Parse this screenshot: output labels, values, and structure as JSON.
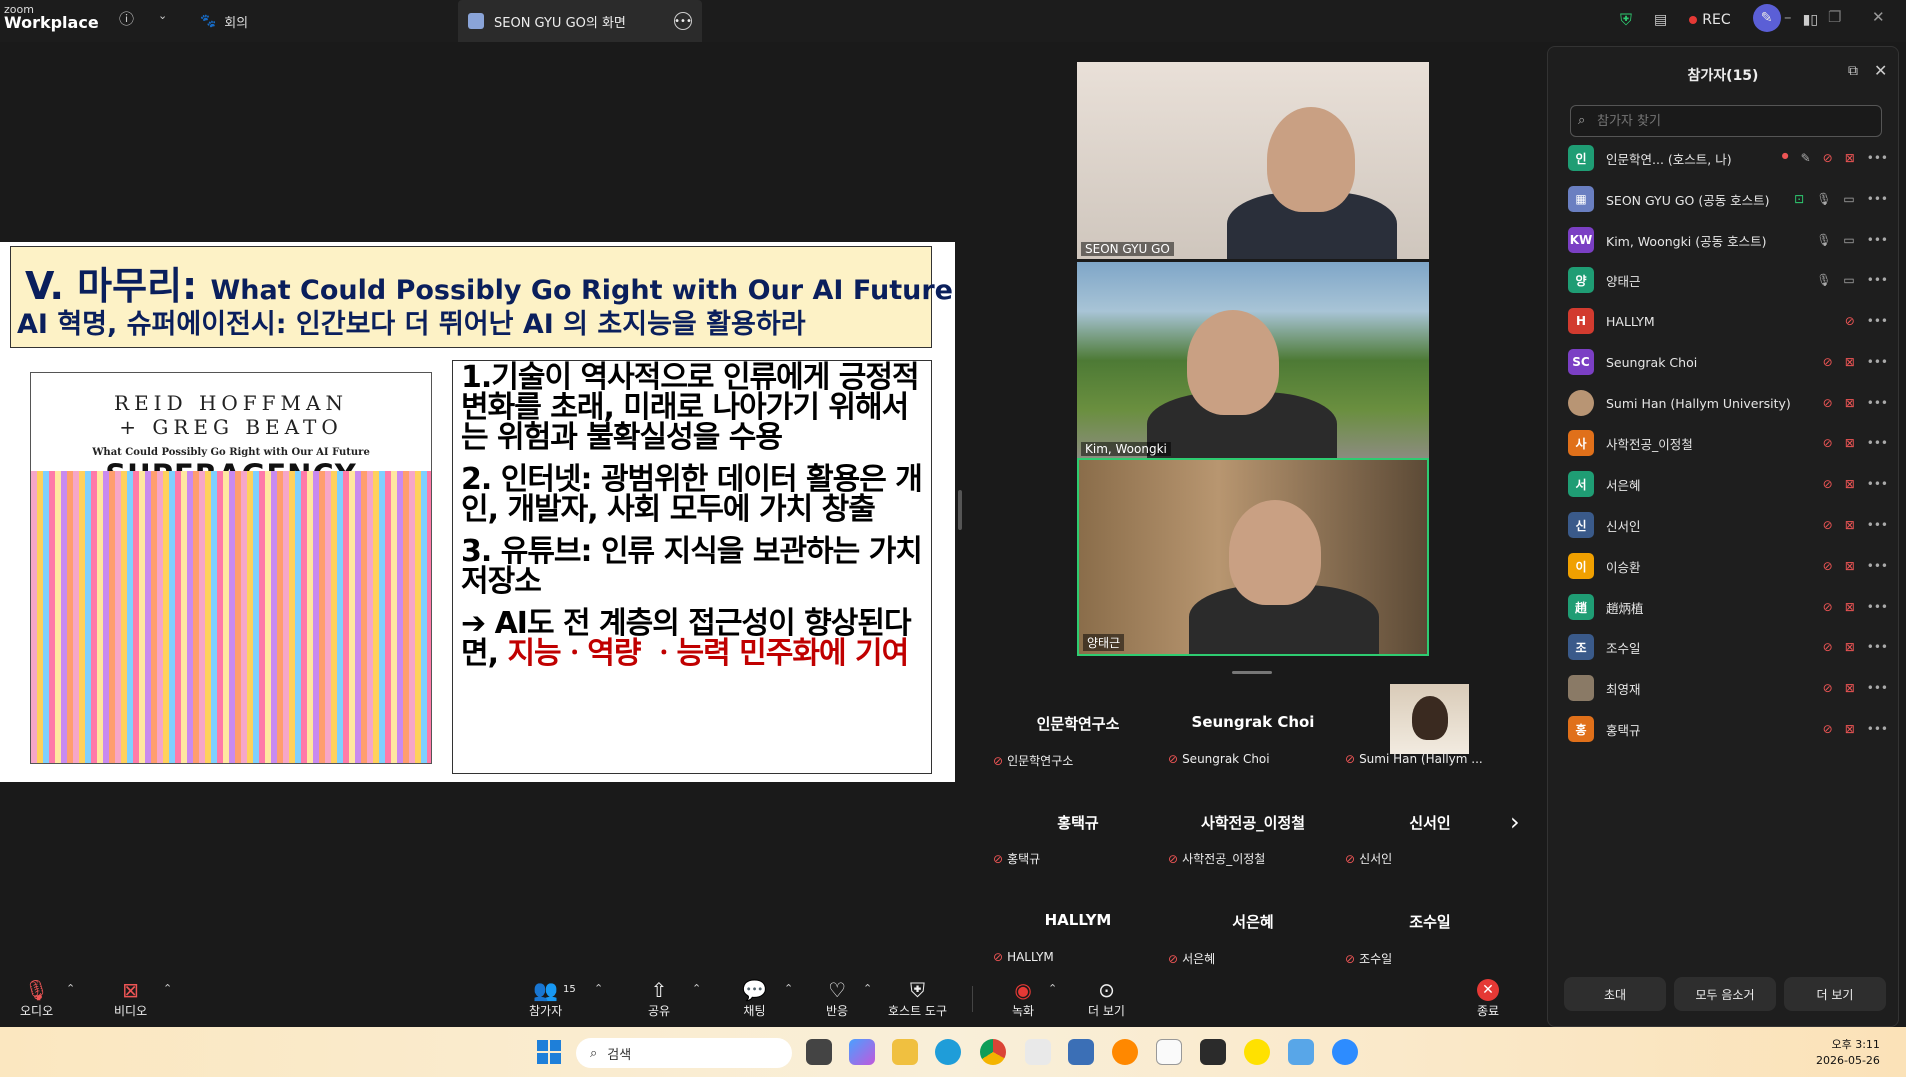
{
  "app": {
    "brand_top": "zoom",
    "brand_bottom": "Workplace"
  },
  "tabs": {
    "meeting": "회의",
    "share": "SEON GYU GO의 화면"
  },
  "status": {
    "rec": "REC"
  },
  "slide": {
    "title_ko": "V. 마무리: ",
    "title_en": "What Could Possibly Go Right with Our AI Future",
    "subtitle": "AI 혁명, 슈퍼에이전시: 인간보다 더 뛰어난 AI 의 초지능을 활용하라",
    "book_author1": "REID HOFFMAN",
    "book_author2": "+ GREG BEATO",
    "book_tagline": "What Could Possibly Go Right with Our AI Future",
    "book_title": "SUPERAGENCY",
    "p1": "1.기술이 역사적으로 인류에게 긍정적 변화를 초래, 미래로 나아가기 위해서는 위험과 불확실성을 수용",
    "p2": "2. 인터넷: 광범위한 데이터 활용은 개인, 개발자, 사회 모두에 가치 창출",
    "p3": "3. 유튜브: 인류 지식을 보관하는 가치 저장소",
    "p4_a": "➔ AI도 전 계층의 접근성이 향상된다면, ",
    "p4_b": "지능ㆍ역량 ㆍ능력 민주화에 기여"
  },
  "videos": [
    {
      "name": "SEON GYU GO"
    },
    {
      "name": "Kim, Woongki"
    },
    {
      "name": "양태근"
    }
  ],
  "gallery": [
    {
      "title": "인문학연구소",
      "sub": "인문학연구소"
    },
    {
      "title": "Seungrak Choi",
      "sub": "Seungrak Choi"
    },
    {
      "title": "",
      "sub": "Sumi Han (Hallym ..."
    },
    {
      "title": "홍택규",
      "sub": "홍택규"
    },
    {
      "title": "사학전공_이정철",
      "sub": "사학전공_이정철"
    },
    {
      "title": "신서인",
      "sub": "신서인"
    },
    {
      "title": "HALLYM",
      "sub": "HALLYM"
    },
    {
      "title": "서은혜",
      "sub": "서은혜"
    },
    {
      "title": "조수일",
      "sub": "조수일"
    }
  ],
  "participants": {
    "title": "참가자(15)",
    "search_placeholder": "참가자 찾기",
    "list": [
      {
        "avatar": "인",
        "color": "#1f9d74",
        "name": "인문학연... (호스트, 나)"
      },
      {
        "avatar": "",
        "color": "#6a7fc1",
        "name": "SEON GYU GO (공동 호스트)"
      },
      {
        "avatar": "KW",
        "color": "#7b3fc4",
        "name": "Kim, Woongki (공동 호스트)"
      },
      {
        "avatar": "양",
        "color": "#1f9d74",
        "name": "양태근"
      },
      {
        "avatar": "H",
        "color": "#d23b2f",
        "name": "HALLYM"
      },
      {
        "avatar": "SC",
        "color": "#7b3fc4",
        "name": "Seungrak Choi"
      },
      {
        "avatar": "",
        "color": "#b89574",
        "name": "Sumi Han (Hallym University)"
      },
      {
        "avatar": "사",
        "color": "#e0701a",
        "name": "사학전공_이정철"
      },
      {
        "avatar": "서",
        "color": "#1f9d74",
        "name": "서은혜"
      },
      {
        "avatar": "신",
        "color": "#3a5a8a",
        "name": "신서인"
      },
      {
        "avatar": "이",
        "color": "#f0a000",
        "name": "이승환"
      },
      {
        "avatar": "趙",
        "color": "#1f9d74",
        "name": "趙炳植"
      },
      {
        "avatar": "조",
        "color": "#3a5a8a",
        "name": "조수일"
      },
      {
        "avatar": "",
        "color": "#8a7a66",
        "name": "최영재"
      },
      {
        "avatar": "홍",
        "color": "#e0701a",
        "name": "홍택규"
      }
    ],
    "buttons": {
      "invite": "초대",
      "mute_all": "모두 음소거",
      "more": "더 보기"
    }
  },
  "toolbar": {
    "audio": "오디오",
    "video": "비디오",
    "participants": "참가자",
    "count": "15",
    "share": "공유",
    "chat": "채팅",
    "reactions": "반응",
    "host_tools": "호스트 도구",
    "record": "녹화",
    "more": "더 보기",
    "end": "종료"
  },
  "taskbar": {
    "search": "검색",
    "time": "오후 3:11",
    "date": "2026-05-26"
  }
}
